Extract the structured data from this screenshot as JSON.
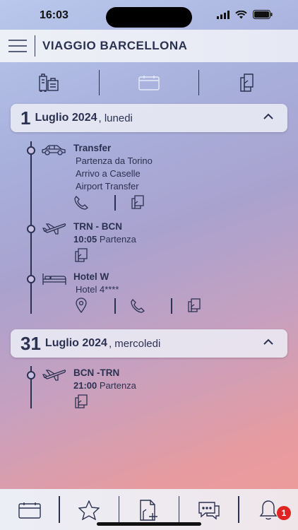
{
  "status": {
    "time": "16:03"
  },
  "header": {
    "title": "VIAGGIO BARCELLONA"
  },
  "days": [
    {
      "num": "1",
      "month_year": "Luglio 2024",
      "weekday": ", lunedi",
      "events": [
        {
          "type": "car",
          "title": "Transfer",
          "lines": [
            "Partenza da Torino",
            "Arrivo a Caselle",
            "Airport Transfer"
          ]
        },
        {
          "type": "plane",
          "title": "TRN - BCN",
          "time": "10:05",
          "time_label": "Partenza"
        },
        {
          "type": "hotel",
          "title": "Hotel W",
          "lines": [
            "Hotel 4****"
          ]
        }
      ]
    },
    {
      "num": "31",
      "month_year": "Luglio 2024",
      "weekday": ", mercoledi",
      "events": [
        {
          "type": "plane",
          "title": "BCN -TRN",
          "time": "21:00",
          "time_label": "Partenza"
        }
      ]
    }
  ],
  "tabbar": {
    "notifications_count": "1"
  },
  "icons": [
    "menu-icon",
    "luggage-icon",
    "calendar-icon",
    "documents-icon",
    "chevron-up-icon",
    "car-icon",
    "plane-icon",
    "bed-icon",
    "phone-icon",
    "document-icon",
    "map-pin-icon",
    "star-icon",
    "add-document-icon",
    "chat-icon",
    "bell-icon"
  ],
  "colors": {
    "ink": "#2b3150",
    "badge": "#e02424"
  }
}
